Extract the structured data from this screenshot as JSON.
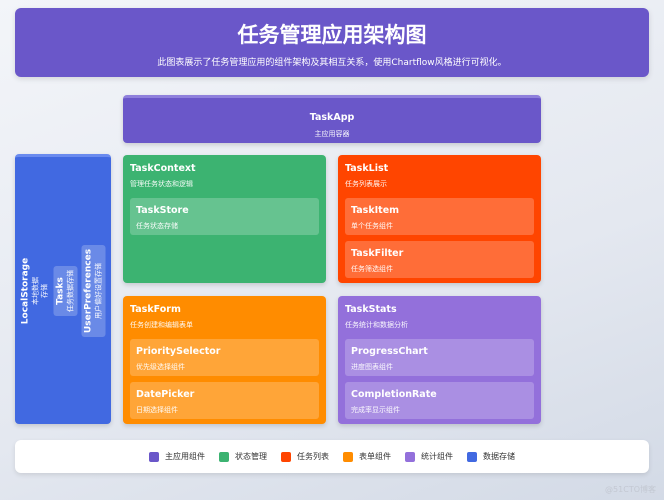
{
  "header": {
    "title": "任务管理应用架构图",
    "subtitle": "此图表展示了任务管理应用的组件架构及其相互关系，使用Chartflow风格进行可视化。"
  },
  "colors": {
    "main": "#6a57c9",
    "state": "#3cb371",
    "list": "#ff4500",
    "form": "#ff8c00",
    "stats": "#9370db",
    "storage": "#4169e1"
  },
  "app": {
    "title": "TaskApp",
    "desc": "主应用容器"
  },
  "storage": {
    "title": "LocalStorage",
    "desc": "本地数据存储",
    "children": [
      {
        "title": "Tasks",
        "desc": "任务数据存储"
      },
      {
        "title": "UserPreferences",
        "desc": "用户偏好设置存储"
      }
    ]
  },
  "context": {
    "title": "TaskContext",
    "desc": "管理任务状态和逻辑",
    "children": [
      {
        "title": "TaskStore",
        "desc": "任务状态存储"
      }
    ]
  },
  "list": {
    "title": "TaskList",
    "desc": "任务列表展示",
    "children": [
      {
        "title": "TaskItem",
        "desc": "单个任务组件"
      },
      {
        "title": "TaskFilter",
        "desc": "任务筛选组件"
      }
    ]
  },
  "form": {
    "title": "TaskForm",
    "desc": "任务创建和编辑表单",
    "children": [
      {
        "title": "PrioritySelector",
        "desc": "优先级选择组件"
      },
      {
        "title": "DatePicker",
        "desc": "日期选择组件"
      }
    ]
  },
  "stats": {
    "title": "TaskStats",
    "desc": "任务统计和数据分析",
    "children": [
      {
        "title": "ProgressChart",
        "desc": "进度图表组件"
      },
      {
        "title": "CompletionRate",
        "desc": "完成率显示组件"
      }
    ]
  },
  "legend": [
    {
      "label": "主应用组件",
      "color": "#6a57c9"
    },
    {
      "label": "状态管理",
      "color": "#3cb371"
    },
    {
      "label": "任务列表",
      "color": "#ff4500"
    },
    {
      "label": "表单组件",
      "color": "#ff8c00"
    },
    {
      "label": "统计组件",
      "color": "#9370db"
    },
    {
      "label": "数据存储",
      "color": "#4169e1"
    }
  ],
  "watermark": "@51CTO博客"
}
